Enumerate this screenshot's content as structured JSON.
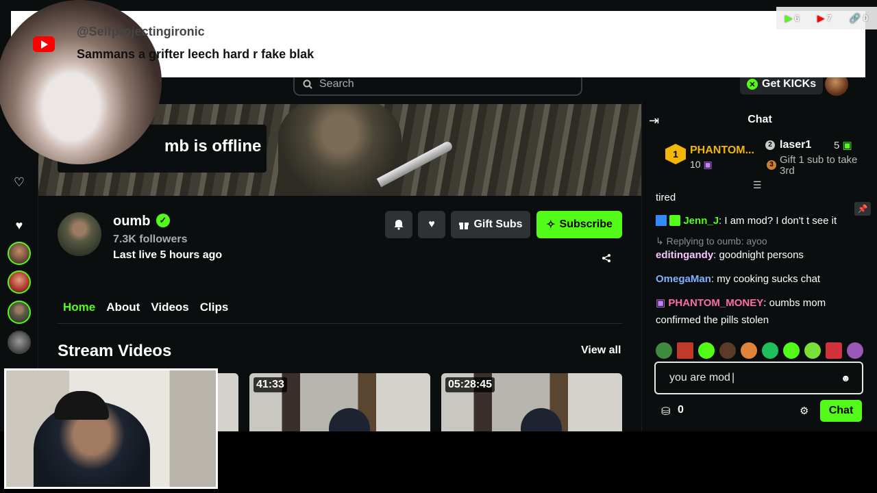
{
  "overlay": {
    "youtube_comment": {
      "handle": "@Selfprojectingironic",
      "message": "Sammans a grifter leech hard r fake blak"
    },
    "stats": {
      "kick_viewers": "6",
      "youtube_viewers": "7",
      "links": "0"
    }
  },
  "header": {
    "search_placeholder": "Search",
    "get_kicks_label": "Get KICKs"
  },
  "banner": {
    "offline_text": "mb is offline"
  },
  "channel": {
    "name": "oumb",
    "followers": "7.3K followers",
    "last_live": "Last live 5 hours ago",
    "gift_subs_label": "Gift Subs",
    "subscribe_label": "Subscribe"
  },
  "tabs": [
    "Home",
    "About",
    "Videos",
    "Clips"
  ],
  "stream_videos": {
    "title": "Stream Videos",
    "view_all_label": "View all",
    "thumbnails": [
      {
        "duration": ""
      },
      {
        "duration": "41:33"
      },
      {
        "duration": "05:28:45"
      }
    ]
  },
  "chat": {
    "title": "Chat",
    "top_gifters": [
      {
        "rank": "1",
        "name": "PHANTOM...",
        "count": "10"
      },
      {
        "rank": "2",
        "name": "laser1",
        "count": "5"
      }
    ],
    "gift_prompt_rank": "3",
    "gift_prompt": "Gift 1 sub to take 3rd",
    "messages": [
      {
        "user": "",
        "text": "tired"
      },
      {
        "user": "Jenn_J",
        "text": ": I am mod? I don't t see it"
      },
      {
        "user": "",
        "text": "Replying to oumb: ayoo"
      },
      {
        "user": "editingandy",
        "text": ": goodnight persons"
      },
      {
        "user": "OmegaMan",
        "text": ": my cooking sucks chat"
      },
      {
        "user": "PHANTOM_MONEY",
        "text": ": oumbs mom confirmed the pills stolen"
      }
    ],
    "input_value": "you are mod",
    "points": "0",
    "send_label": "Chat"
  },
  "colors": {
    "kick_green": "#53fc18",
    "background": "#0b0e0f",
    "youtube_red": "#ff0000",
    "gold": "#f2b705"
  }
}
